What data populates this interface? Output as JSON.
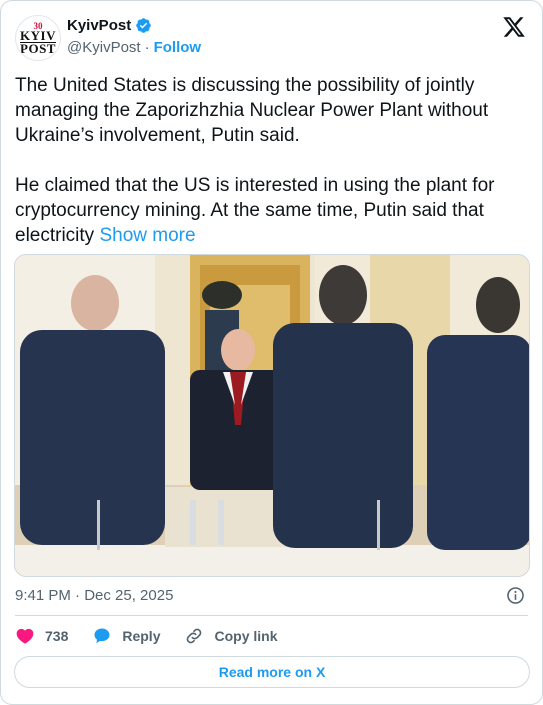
{
  "account": {
    "display_name": "KyivPost",
    "handle": "@KyivPost",
    "separator": "·",
    "follow_label": "Follow",
    "logo_number": "30",
    "logo_line1": "KYIV",
    "logo_line2": "POST"
  },
  "tweet": {
    "paragraph1": "The United States is discussing the possibility of jointly managing the Zaporizhzhia Nuclear Power Plant without Ukraine’s involvement, Putin said.",
    "paragraph2": "He claimed that the US is interested in using the plant for cryptocurrency mining. At the same time, Putin said that electricity",
    "show_more_label": "Show more",
    "timestamp": "9:41 PM · Dec 25, 2025"
  },
  "actions": {
    "like_count": "738",
    "reply_label": "Reply",
    "copy_link_label": "Copy link",
    "read_more_label": "Read more on X"
  },
  "icons": {
    "verified": "verified-badge-icon",
    "x_logo": "x-logo-icon",
    "info": "info-icon",
    "like": "heart-icon",
    "reply": "speech-bubble-icon",
    "copy_link": "link-icon"
  },
  "colors": {
    "accent": "#1d9bf0",
    "like": "#f91880",
    "text": "#0f1419",
    "muted": "#536471",
    "border": "#cfd9de"
  }
}
